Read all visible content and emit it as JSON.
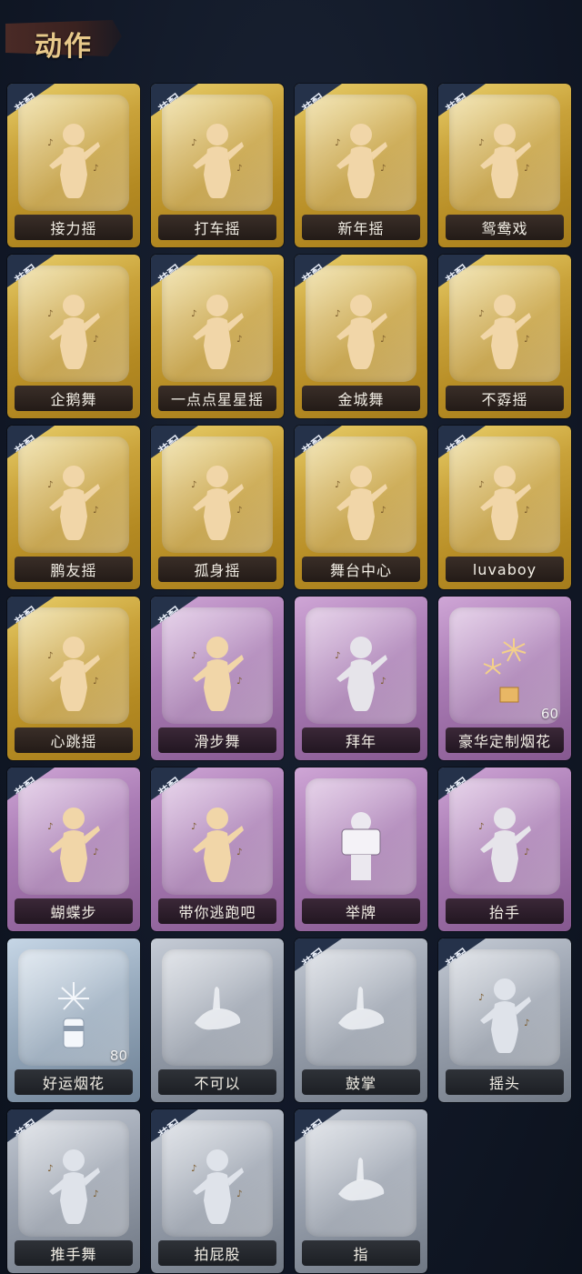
{
  "header": {
    "title": "动作"
  },
  "colors": {
    "gold": "#c9a23a",
    "purple": "#a97bb4",
    "silver": "#98a0ad",
    "blue": "#97aabd",
    "equip_tag": "#25324a",
    "background": "#111827"
  },
  "equip_label": "装配",
  "cards": [
    {
      "label": "接力摇",
      "rarity": "gold",
      "equipped": true,
      "icon": "dancer-figure-icon"
    },
    {
      "label": "打车摇",
      "rarity": "gold",
      "equipped": true,
      "icon": "dancer-figure-icon"
    },
    {
      "label": "新年摇",
      "rarity": "gold",
      "equipped": true,
      "icon": "dancer-figure-icon"
    },
    {
      "label": "鸳鸯戏",
      "rarity": "gold",
      "equipped": true,
      "icon": "dancer-figure-icon"
    },
    {
      "label": "企鹅舞",
      "rarity": "gold",
      "equipped": true,
      "icon": "dancer-figure-icon"
    },
    {
      "label": "一点点星星摇",
      "rarity": "gold",
      "equipped": true,
      "icon": "dancer-figure-icon"
    },
    {
      "label": "金城舞",
      "rarity": "gold",
      "equipped": true,
      "icon": "dancer-figure-icon"
    },
    {
      "label": "不孬摇",
      "rarity": "gold",
      "equipped": true,
      "icon": "dancer-figure-icon"
    },
    {
      "label": "鹏友摇",
      "rarity": "gold",
      "equipped": true,
      "icon": "dancer-figure-icon"
    },
    {
      "label": "孤身摇",
      "rarity": "gold",
      "equipped": true,
      "icon": "dancer-figure-icon"
    },
    {
      "label": "舞台中心",
      "rarity": "gold",
      "equipped": true,
      "icon": "dancer-figure-icon"
    },
    {
      "label": "luvaboy",
      "rarity": "gold",
      "equipped": true,
      "icon": "dancer-figure-icon"
    },
    {
      "label": "心跳摇",
      "rarity": "gold",
      "equipped": true,
      "icon": "dancer-figure-icon"
    },
    {
      "label": "滑步舞",
      "rarity": "purple",
      "equipped": true,
      "icon": "dancer-figure-icon"
    },
    {
      "label": "拜年",
      "rarity": "purple",
      "equipped": false,
      "icon": "bowing-figure-icon"
    },
    {
      "label": "豪华定制烟花",
      "rarity": "purple",
      "equipped": false,
      "icon": "fireworks-icon",
      "count": "60"
    },
    {
      "label": "蝴蝶步",
      "rarity": "purple",
      "equipped": true,
      "icon": "dancer-figure-icon"
    },
    {
      "label": "带你逃跑吧",
      "rarity": "purple",
      "equipped": true,
      "icon": "dancer-figure-icon"
    },
    {
      "label": "举牌",
      "rarity": "purple",
      "equipped": false,
      "icon": "holding-sign-icon"
    },
    {
      "label": "抬手",
      "rarity": "purple",
      "equipped": true,
      "icon": "raise-hand-icon"
    },
    {
      "label": "好运烟花",
      "rarity": "blue",
      "equipped": false,
      "icon": "firework-can-icon",
      "count": "80"
    },
    {
      "label": "不可以",
      "rarity": "silver",
      "equipped": false,
      "icon": "finger-wag-icon"
    },
    {
      "label": "鼓掌",
      "rarity": "silver",
      "equipped": true,
      "icon": "clapping-hands-icon"
    },
    {
      "label": "摇头",
      "rarity": "silver",
      "equipped": true,
      "icon": "shaking-head-icon"
    },
    {
      "label": "推手舞",
      "rarity": "silver",
      "equipped": true,
      "icon": "push-hands-icon"
    },
    {
      "label": "拍屁股",
      "rarity": "silver",
      "equipped": true,
      "icon": "slap-icon"
    },
    {
      "label": "指",
      "rarity": "silver",
      "equipped": true,
      "icon": "pointing-hand-icon"
    }
  ]
}
